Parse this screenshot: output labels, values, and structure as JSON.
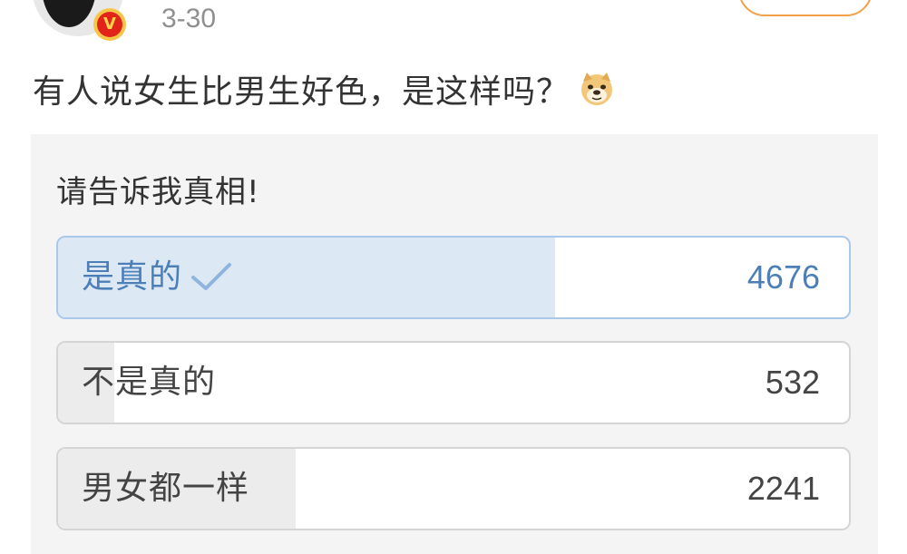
{
  "header": {
    "date": "3-30",
    "verified_badge": "V"
  },
  "post": {
    "text": "有人说女生比男生好色，是这样吗？",
    "emoji": "doge-icon"
  },
  "poll": {
    "title": "请告诉我真相!",
    "options": [
      {
        "label": "是真的",
        "count": "4676",
        "selected": true,
        "share": 0.628
      },
      {
        "label": "不是真的",
        "count": "532",
        "selected": false,
        "share": 0.0715
      },
      {
        "label": "男女都一样",
        "count": "2241",
        "selected": false,
        "share": 0.301
      }
    ]
  },
  "colors": {
    "selected_text": "#4c7fb8",
    "selected_fill": "#dde8f5",
    "selected_border": "#a9c8ea",
    "unselected_fill": "#ececec",
    "follow_border": "#f4a04a",
    "verified_red": "#e2231a",
    "verified_gold": "#f5c64a"
  }
}
